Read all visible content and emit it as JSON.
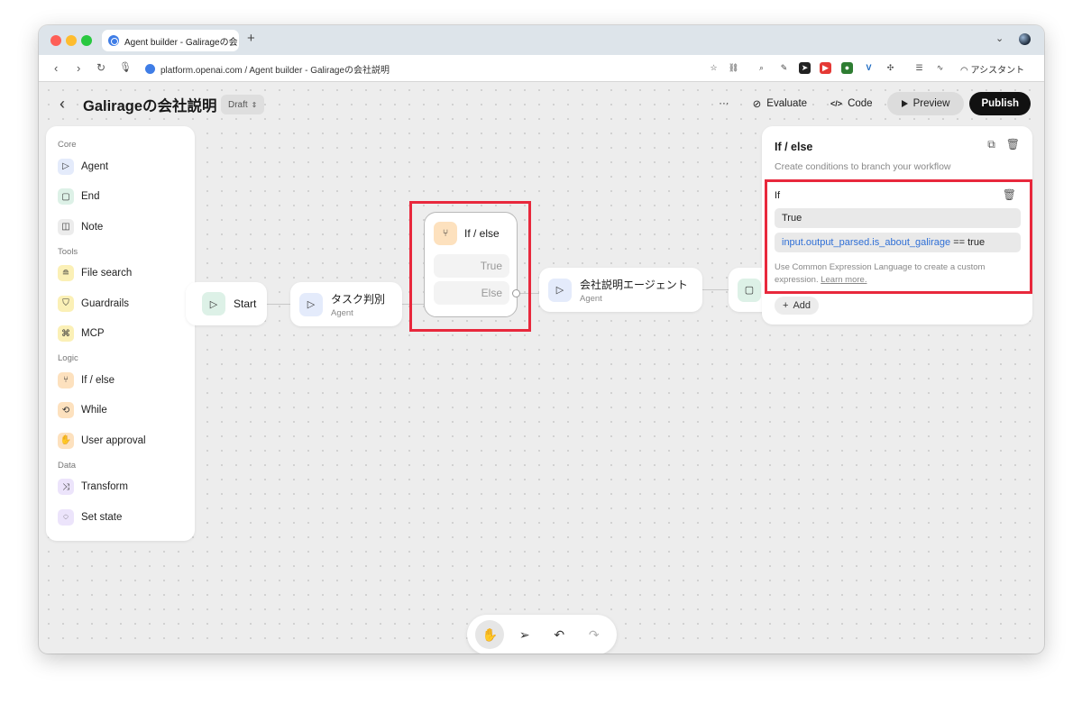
{
  "browser": {
    "tab_title": "Agent builder - Galirageの会",
    "new_tab": "+",
    "url": "platform.openai.com / Agent builder - Galirageの会社説明",
    "assistant_label": "アシスタント"
  },
  "header": {
    "back": "‹",
    "title": "Galirageの会社説明",
    "draft_label": "Draft",
    "more": "···",
    "evaluate_label": "Evaluate",
    "code_label": "Code",
    "code_icon": "</>",
    "preview_label": "Preview",
    "publish_label": "Publish"
  },
  "palette": {
    "sections": [
      {
        "title": "Core",
        "items": [
          {
            "label": "Agent",
            "icon": "agent-icon"
          },
          {
            "label": "End",
            "icon": "end-icon"
          },
          {
            "label": "Note",
            "icon": "note-icon"
          }
        ]
      },
      {
        "title": "Tools",
        "items": [
          {
            "label": "File search",
            "icon": "database-icon"
          },
          {
            "label": "Guardrails",
            "icon": "shield-icon"
          },
          {
            "label": "MCP",
            "icon": "grid-icon"
          }
        ]
      },
      {
        "title": "Logic",
        "items": [
          {
            "label": "If / else",
            "icon": "branch-icon"
          },
          {
            "label": "While",
            "icon": "loop-icon"
          },
          {
            "label": "User approval",
            "icon": "approval-icon"
          }
        ]
      },
      {
        "title": "Data",
        "items": [
          {
            "label": "Transform",
            "icon": "transform-icon"
          },
          {
            "label": "Set state",
            "icon": "state-icon"
          }
        ]
      }
    ]
  },
  "canvas": {
    "start": {
      "title": "Start"
    },
    "task_agent": {
      "title": "タスク判別",
      "subtitle": "Agent"
    },
    "ifelse": {
      "title": "If / else",
      "true_label": "True",
      "else_label": "Else"
    },
    "company_agent": {
      "title": "会社説明エージェント",
      "subtitle": "Agent"
    }
  },
  "panel": {
    "title": "If / else",
    "subtitle": "Create conditions to branch your workflow",
    "if_label": "If",
    "case_name": "True",
    "expression_var": "input.output_parsed.is_about_galirage",
    "expression_rest": " == true",
    "help_text": "Use Common Expression Language to create a custom expression.",
    "learn_more": "Learn more.",
    "add_label": "Add"
  },
  "colors": {
    "highlight": "#e8283c",
    "expression_var": "#2f6fd6"
  }
}
